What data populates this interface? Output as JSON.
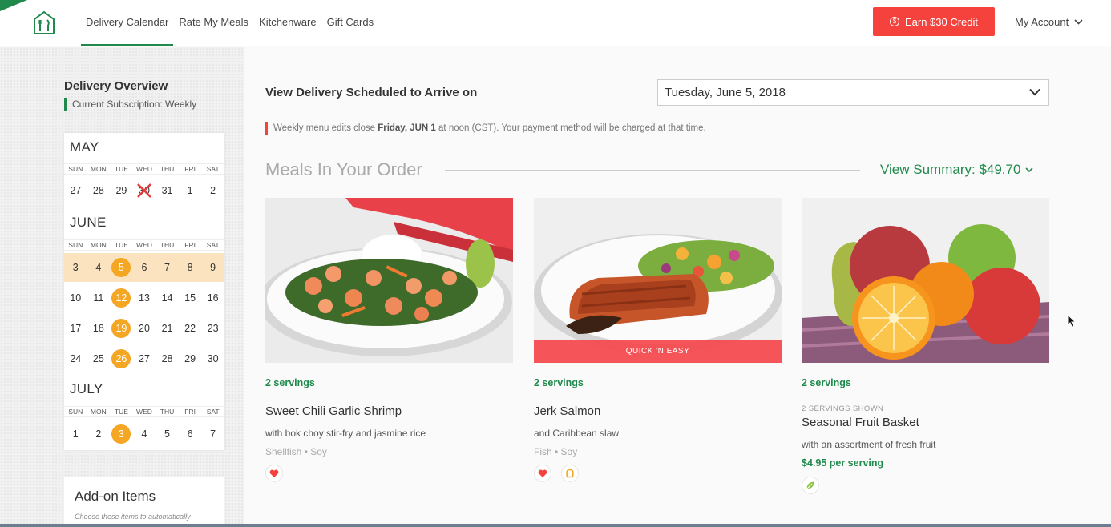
{
  "header": {
    "nav": [
      {
        "label": "Delivery Calendar",
        "active": true
      },
      {
        "label": "Rate My Meals"
      },
      {
        "label": "Kitchenware"
      },
      {
        "label": "Gift Cards"
      }
    ],
    "earn_label": "Earn $30 Credit",
    "account_label": "My Account",
    "brand_color": "#1f8a4c",
    "accent_color": "#f5423c"
  },
  "sidebar": {
    "title": "Delivery Overview",
    "subscription": "Current Subscription: Weekly",
    "weekdays": [
      "SUN",
      "MON",
      "TUE",
      "WED",
      "THU",
      "FRI",
      "SAT"
    ],
    "months": [
      {
        "name": "MAY",
        "weeks": [
          [
            "27",
            "28",
            "29",
            "30",
            "31",
            "1",
            "2"
          ]
        ],
        "crossed": "30"
      },
      {
        "name": "JUNE",
        "weeks": [
          [
            "3",
            "4",
            "5",
            "6",
            "7",
            "8",
            "9"
          ],
          [
            "10",
            "11",
            "12",
            "13",
            "14",
            "15",
            "16"
          ],
          [
            "17",
            "18",
            "19",
            "20",
            "21",
            "22",
            "23"
          ],
          [
            "24",
            "25",
            "26",
            "27",
            "28",
            "29",
            "30"
          ]
        ],
        "selected_week": 0,
        "delivery_days": [
          "5",
          "12",
          "19",
          "26"
        ]
      },
      {
        "name": "JULY",
        "weeks": [
          [
            "1",
            "2",
            "3",
            "4",
            "5",
            "6",
            "7"
          ]
        ],
        "delivery_days": [
          "3"
        ]
      }
    ],
    "addon_title": "Add-on Items",
    "addon_sub": "Choose these items to automatically"
  },
  "main": {
    "view_label": "View Delivery Scheduled to Arrive on",
    "selected_date": "Tuesday, June 5, 2018",
    "notice_pre": "Weekly menu edits close ",
    "notice_bold": "Friday, JUN 1",
    "notice_post": " at noon (CST). Your payment method will be charged at that time.",
    "meals_heading": "Meals In Your Order",
    "summary_label": "View Summary: $49.70",
    "meals": [
      {
        "servings": "2 servings",
        "name": "Sweet Chili Garlic Shrimp",
        "desc": "with bok choy stir-fry and jasmine rice",
        "tags": "Shellfish  •  Soy",
        "icons": [
          "heart-icon"
        ]
      },
      {
        "servings": "2 servings",
        "name": "Jerk Salmon",
        "desc": "and Caribbean slaw",
        "tags": "Fish  •  Soy",
        "badge": "QUICK 'N EASY",
        "icons": [
          "heart-icon",
          "bread-icon"
        ]
      },
      {
        "servings": "2 servings",
        "shown": "2 SERVINGS SHOWN",
        "name": "Seasonal Fruit Basket",
        "desc": "with an assortment of fresh fruit",
        "price": "$4.95 per serving",
        "icons": [
          "leaf-icon"
        ]
      }
    ]
  }
}
